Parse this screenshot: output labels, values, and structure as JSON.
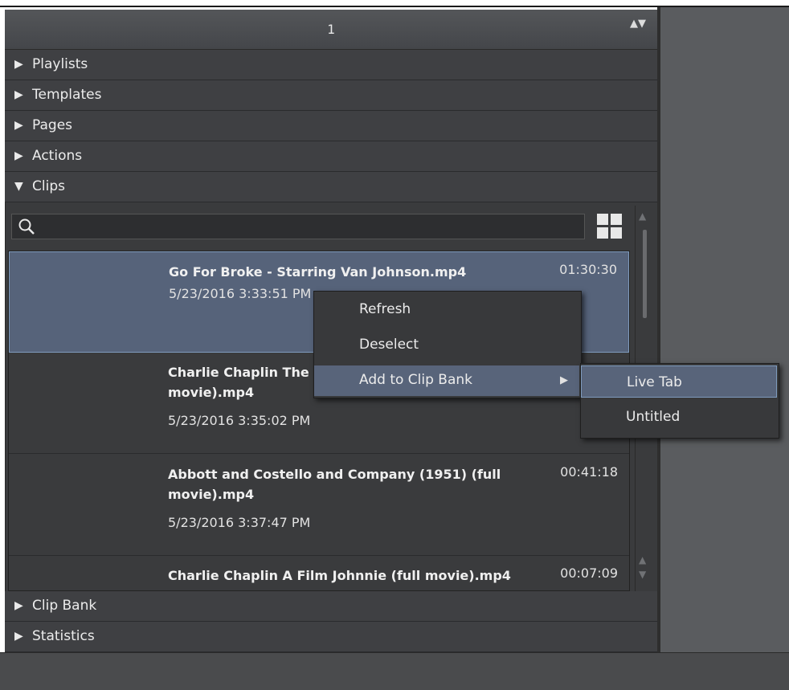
{
  "selector": {
    "value": "1",
    "updown": "▲▼"
  },
  "sections_top": [
    {
      "label": "Playlists",
      "arrow": "▶"
    },
    {
      "label": "Templates",
      "arrow": "▶"
    },
    {
      "label": "Pages",
      "arrow": "▶"
    },
    {
      "label": "Actions",
      "arrow": "▶"
    },
    {
      "label": "Clips",
      "arrow": "▼"
    }
  ],
  "search": {
    "placeholder": "",
    "value": ""
  },
  "clips": [
    {
      "name": "Go For Broke - Starring Van Johnson.mp4",
      "date": "5/23/2016 3:33:51 PM",
      "duration": "01:30:30"
    },
    {
      "name": "Charlie Chaplin The Knockout (1914) (full movie).mp4",
      "date": "5/23/2016 3:35:02 PM",
      "duration": ""
    },
    {
      "name": "Abbott and Costello and Company (1951) (full movie).mp4",
      "date": "5/23/2016 3:37:47 PM",
      "duration": "00:41:18"
    },
    {
      "name": "Charlie Chaplin A Film Johnnie (full movie).mp4",
      "date": "",
      "duration": "00:07:09"
    }
  ],
  "sections_bottom": [
    {
      "label": "Clip Bank",
      "arrow": "▶"
    },
    {
      "label": "Statistics",
      "arrow": "▶"
    }
  ],
  "context_menu": {
    "items": [
      "Refresh",
      "Deselect",
      "Add to Clip Bank"
    ],
    "submenu_arrow": "▶"
  },
  "submenu": {
    "items": [
      "Live Tab",
      "Untitled"
    ]
  },
  "colors": {
    "panel": "#3a3b3d",
    "selection": "#56637a",
    "highlight_border": "#7f9bbd"
  }
}
